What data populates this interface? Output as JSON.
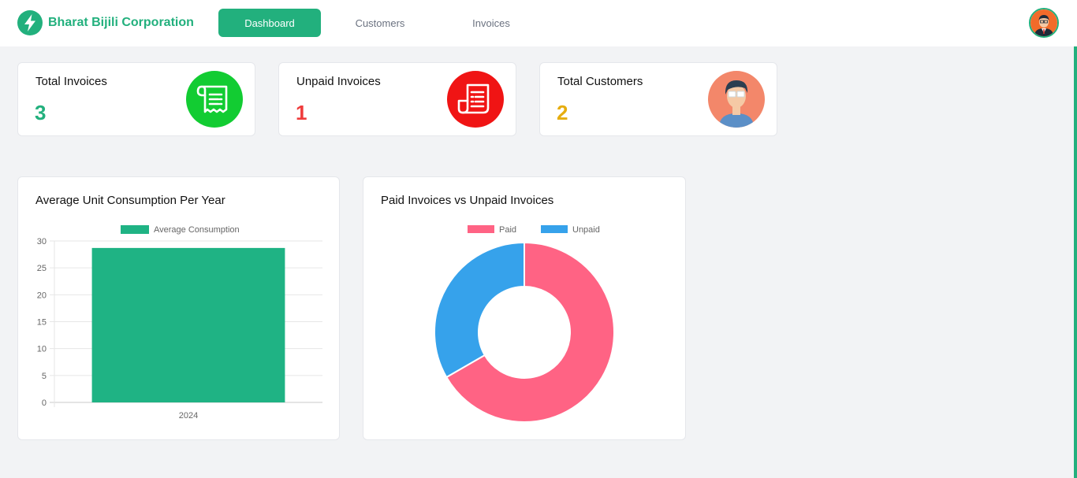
{
  "app": {
    "brand_name": "Bharat Bijili Corporation",
    "accent_color": "#22b07d"
  },
  "nav": {
    "tabs": [
      {
        "label": "Dashboard",
        "active": true
      },
      {
        "label": "Customers",
        "active": false
      },
      {
        "label": "Invoices",
        "active": false
      }
    ]
  },
  "stats": {
    "total_invoices": {
      "label": "Total Invoices",
      "value": "3",
      "color": "#22b07d",
      "icon": "receipt-icon",
      "icon_bg": "#12cc32"
    },
    "unpaid_invoices": {
      "label": "Unpaid Invoices",
      "value": "1",
      "color": "#ef3b3b",
      "icon": "invoice-icon",
      "icon_bg": "#f01414"
    },
    "total_customers": {
      "label": "Total Customers",
      "value": "2",
      "color": "#e6ad0f",
      "icon": "customer-avatar-icon",
      "icon_bg": "#f3876a"
    }
  },
  "panels": {
    "consumption": {
      "title": "Average Unit Consumption Per Year"
    },
    "paid_unpaid": {
      "title": "Paid Invoices vs Unpaid Invoices"
    }
  },
  "chart_data": [
    {
      "type": "bar",
      "title": "Average Unit Consumption Per Year",
      "categories": [
        "2024"
      ],
      "series": [
        {
          "name": "Average Consumption",
          "values": [
            28.7
          ],
          "color": "#1fb384"
        }
      ],
      "ylim": [
        0,
        30
      ],
      "yticks": [
        "0",
        "5",
        "10",
        "15",
        "20",
        "25",
        "30"
      ],
      "grid": true,
      "legend": "top"
    },
    {
      "type": "pie",
      "variant": "doughnut",
      "title": "Paid Invoices vs Unpaid Invoices",
      "labels": [
        "Paid",
        "Unpaid"
      ],
      "values": [
        2,
        1
      ],
      "colors": [
        "#ff6384",
        "#36a2eb"
      ],
      "legend": "top"
    }
  ]
}
